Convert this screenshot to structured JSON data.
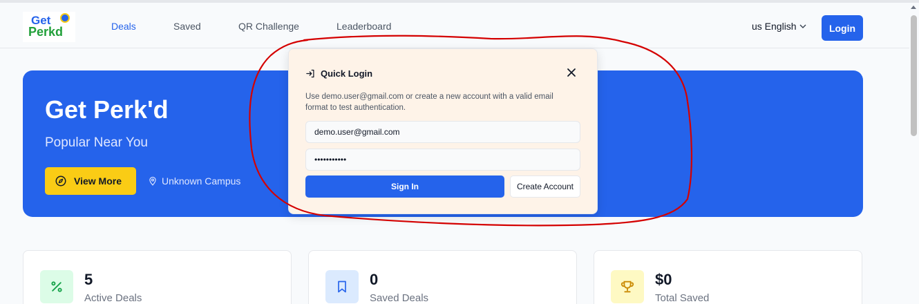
{
  "brand": {
    "line1": "Get",
    "line2": "Perkd"
  },
  "nav": {
    "links": [
      {
        "label": "Deals",
        "active": true
      },
      {
        "label": "Saved",
        "active": false
      },
      {
        "label": "QR Challenge",
        "active": false
      },
      {
        "label": "Leaderboard",
        "active": false
      }
    ],
    "language": "us English",
    "login_label": "Login"
  },
  "hero": {
    "title": "Get Perk'd",
    "subtitle": "Popular Near You",
    "cta_label": "View More",
    "location": "Unknown Campus"
  },
  "stats": [
    {
      "value": "5",
      "label": "Active Deals",
      "icon": "percent-icon",
      "icon_color": "#16a34a",
      "icon_bg": "#dcfce7"
    },
    {
      "value": "0",
      "label": "Saved Deals",
      "icon": "bookmark-icon",
      "icon_color": "#2563eb",
      "icon_bg": "#dbeafe"
    },
    {
      "value": "$0",
      "label": "Total Saved",
      "icon": "trophy-icon",
      "icon_color": "#ca8a04",
      "icon_bg": "#fef9c3"
    }
  ],
  "modal": {
    "title": "Quick Login",
    "description": "Use demo.user@gmail.com or create a new account with a valid email format to test authentication.",
    "email_value": "demo.user@gmail.com",
    "password_value": "•••••••••••",
    "signin_label": "Sign In",
    "create_label": "Create Account"
  },
  "colors": {
    "primary": "#2563eb",
    "accent_yellow": "#facc15",
    "annotation_red": "#d40000",
    "modal_bg": "#fef3e8"
  }
}
